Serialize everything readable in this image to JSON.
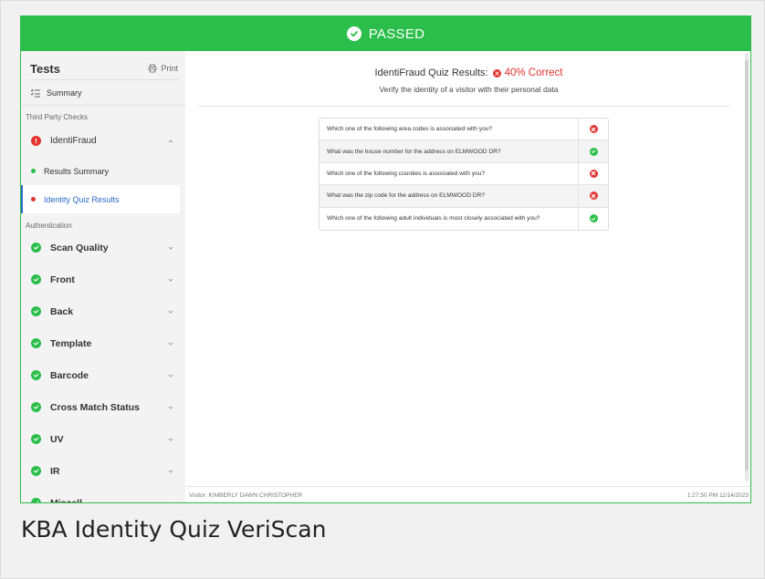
{
  "banner": {
    "status": "PASSED",
    "color": "#2bbe4a"
  },
  "sidebar": {
    "title": "Tests",
    "print_label": "Print",
    "summary_label": "Summary",
    "section_third_party": "Third Party Checks",
    "identifraud": {
      "label": "IdentiFraud",
      "status": "fail"
    },
    "sub_items": [
      {
        "label": "Results Summary",
        "status": "pass",
        "active": false
      },
      {
        "label": "Identity Quiz Results",
        "status": "fail",
        "active": true
      }
    ],
    "section_auth": "Authentication",
    "auth_items": [
      {
        "label": "Scan Quality",
        "status": "pass"
      },
      {
        "label": "Front",
        "status": "pass"
      },
      {
        "label": "Back",
        "status": "pass"
      },
      {
        "label": "Template",
        "status": "pass"
      },
      {
        "label": "Barcode",
        "status": "pass"
      },
      {
        "label": "Cross Match Status",
        "status": "pass"
      },
      {
        "label": "UV",
        "status": "pass"
      },
      {
        "label": "IR",
        "status": "pass"
      },
      {
        "label": "Miscell...",
        "status": "pass"
      }
    ]
  },
  "main": {
    "title": "IdentiFraud Quiz Results:",
    "percent_label": "40% Correct",
    "subtitle": "Verify the identity of a visitor with their personal data",
    "questions": [
      {
        "text": "Which one of the following area codes is associated with you?",
        "result": "incorrect"
      },
      {
        "text": "What was the house number for the address on ELMWOOD DR?",
        "result": "correct"
      },
      {
        "text": "Which one of the following counties is associated with you?",
        "result": "incorrect"
      },
      {
        "text": "What was the zip code for the address on ELMWOOD DR?",
        "result": "incorrect"
      },
      {
        "text": "Which one of the following adult individuals is most closely associated with you?",
        "result": "correct"
      }
    ]
  },
  "footer": {
    "visitor": "Visitor: KIMBERLY DAWN CHRISTOPHER",
    "timestamp": "1:27:50 PM 11/14/2023"
  },
  "caption": "KBA Identity Quiz VeriScan",
  "colors": {
    "pass": "#2bbe4a",
    "fail": "#e2332f",
    "active": "#2b6ac9"
  }
}
